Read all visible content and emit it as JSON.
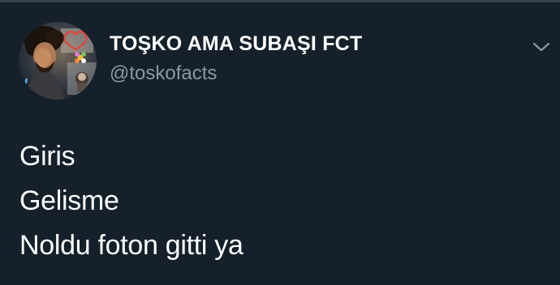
{
  "tweet": {
    "author": {
      "display_name": "TOŞKO AMA SUBAŞI FCT",
      "handle": "@toskofacts",
      "avatar_icon": "profile-photo"
    },
    "menu_icon": "chevron-down-icon",
    "lines": [
      "Giris",
      "Gelisme",
      "Noldu foton gitti ya"
    ]
  },
  "colors": {
    "background": "#15202b",
    "primary_text": "#ffffff",
    "secondary_text": "#8899a6",
    "divider": "#38444d"
  }
}
